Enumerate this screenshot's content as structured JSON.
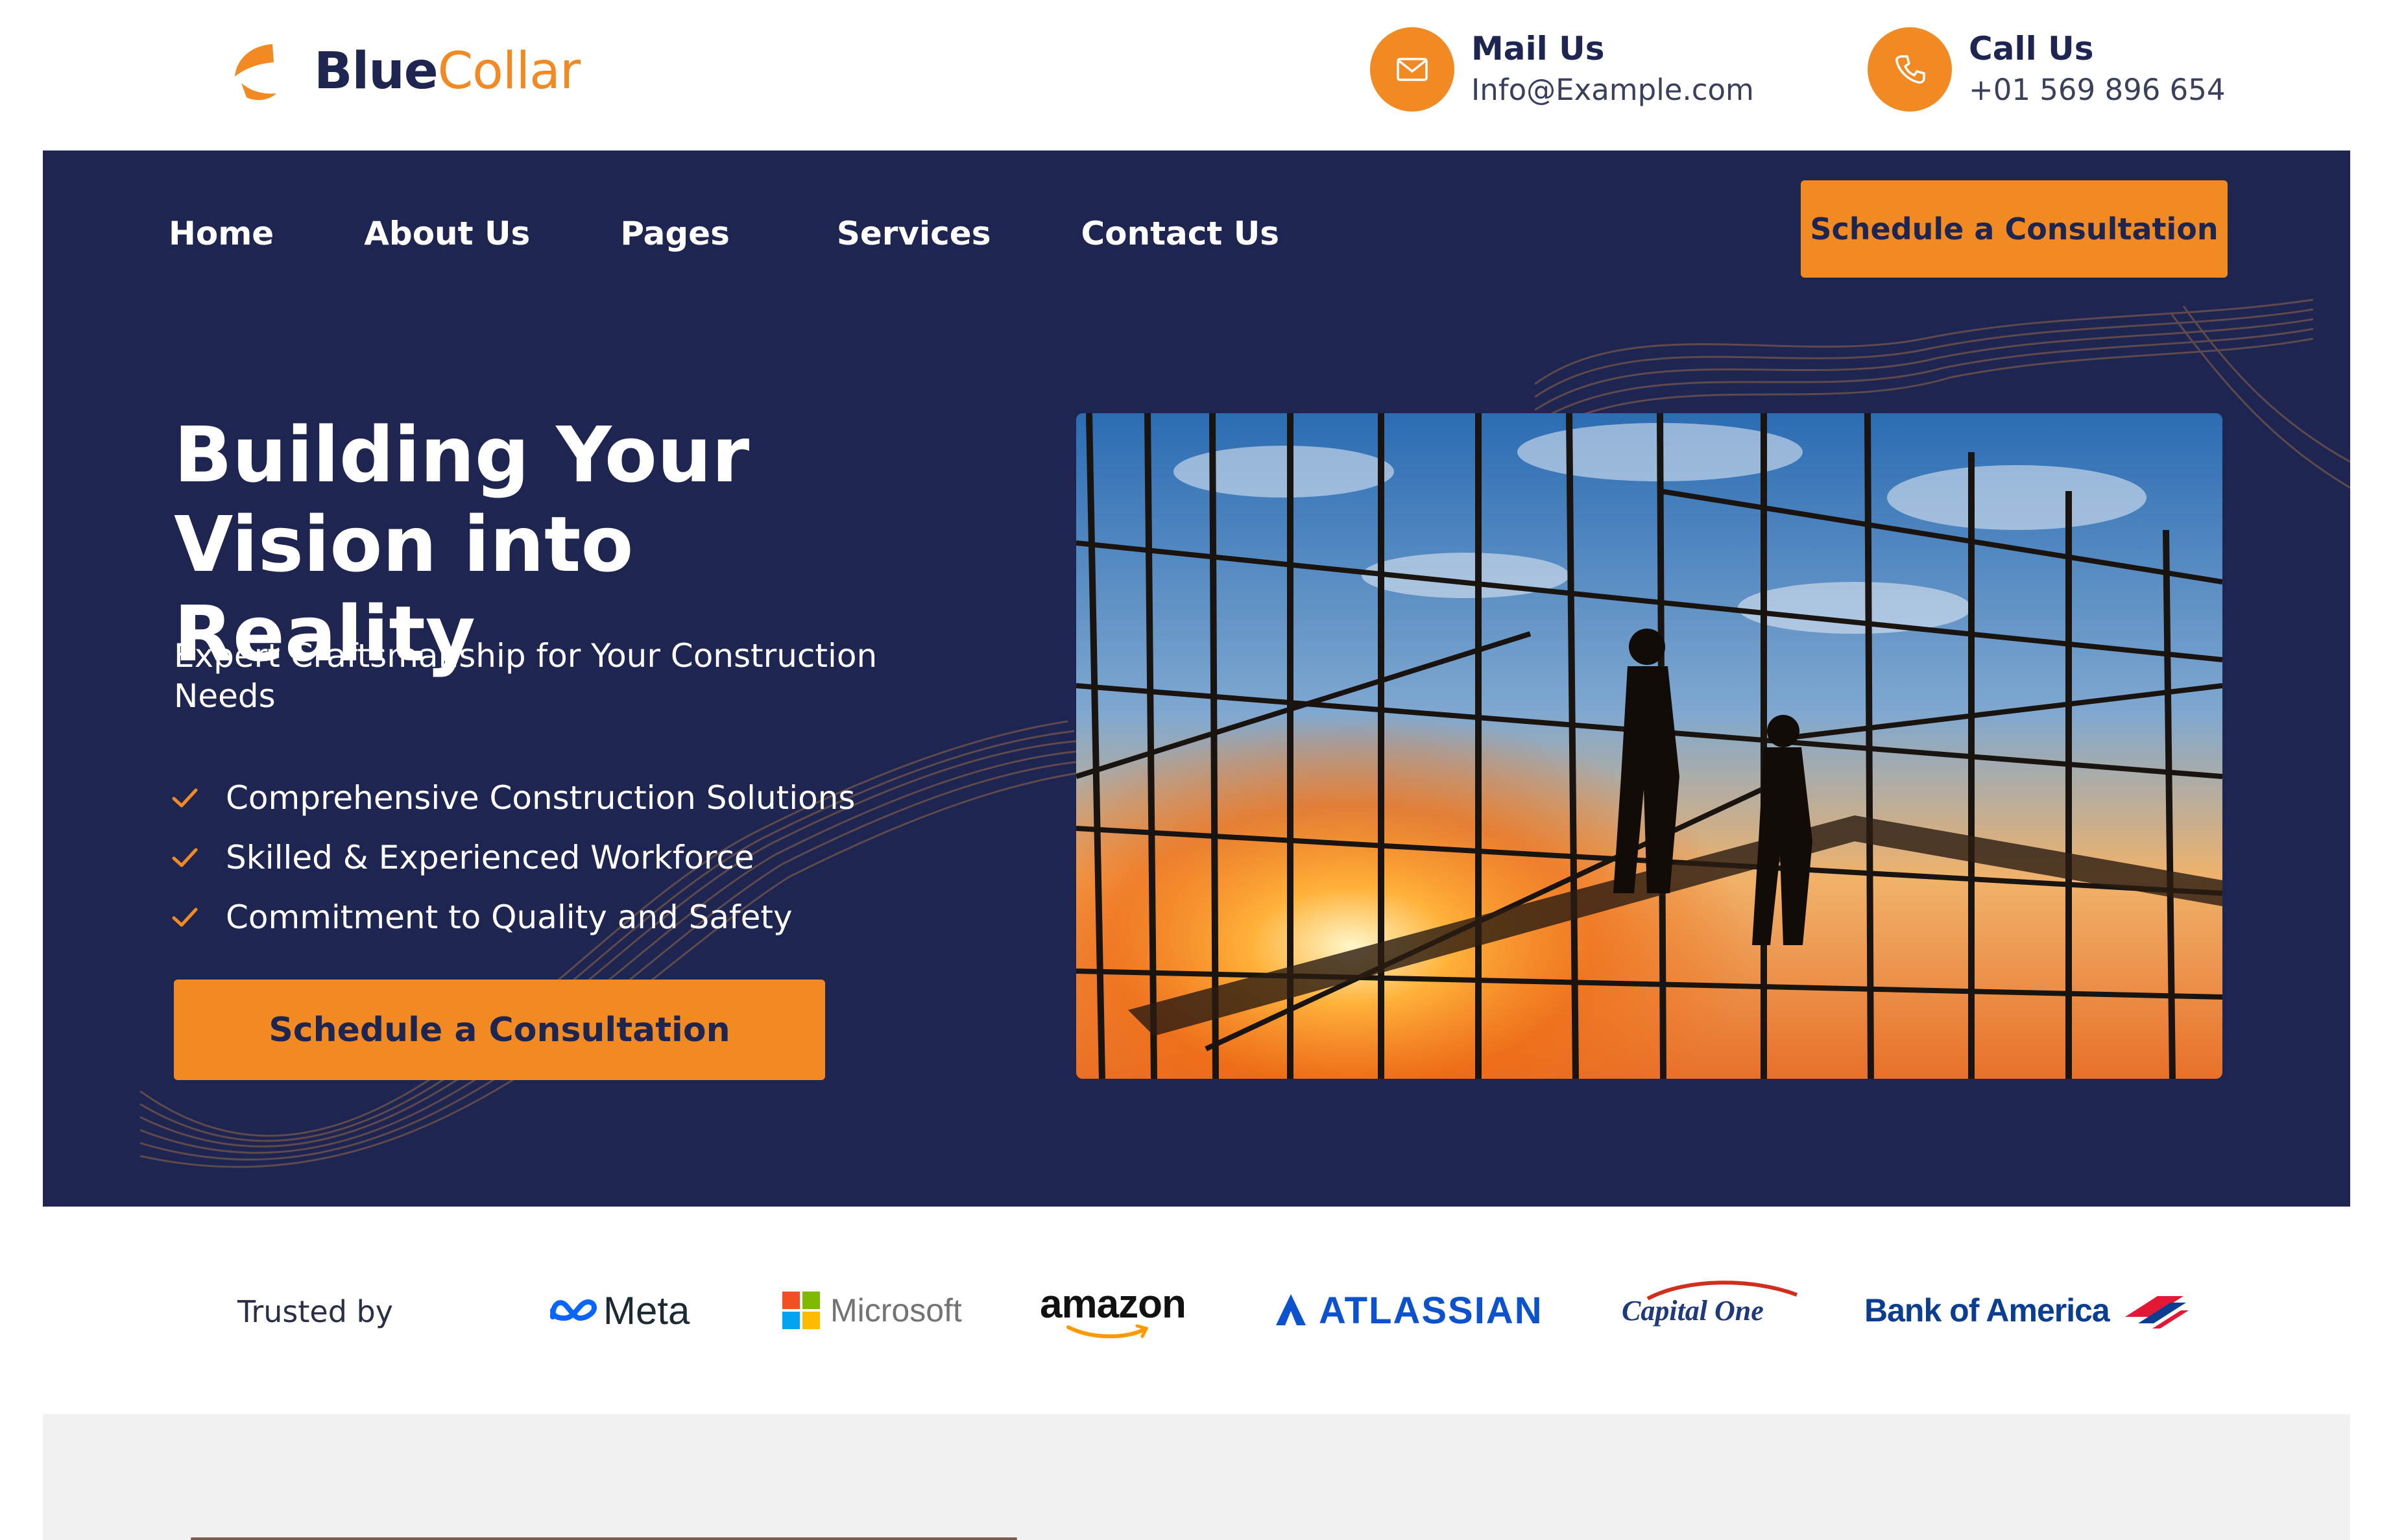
{
  "brand": {
    "name_part1": "Blue",
    "name_part2": "Collar"
  },
  "contact": {
    "mail": {
      "title": "Mail Us",
      "value": "Info@Example.com",
      "icon": "mail-icon"
    },
    "call": {
      "title": "Call Us",
      "value": "+01 569 896 654",
      "icon": "phone-icon"
    }
  },
  "nav": {
    "items": [
      "Home",
      "About Us",
      "Pages",
      "Services",
      "Contact Us"
    ],
    "cta": "Schedule a Consultation"
  },
  "hero": {
    "title_line1": "Building Your",
    "title_line2": "Vision into Reality",
    "subtitle": "Expert Craftsmanship for Your Construction Needs",
    "features": [
      "Comprehensive Construction Solutions",
      "Skilled & Experienced Workforce",
      "Commitment to Quality and Safety"
    ],
    "cta": "Schedule a Consultation"
  },
  "trusted": {
    "label": "Trusted by",
    "brands": [
      "Meta",
      "Microsoft",
      "amazon",
      "ATLASSIAN",
      "Capital One",
      "Bank of America"
    ]
  },
  "colors": {
    "navy": "#1e2551",
    "orange": "#f28a24",
    "white": "#ffffff",
    "light_gray": "#f1f1f1"
  }
}
